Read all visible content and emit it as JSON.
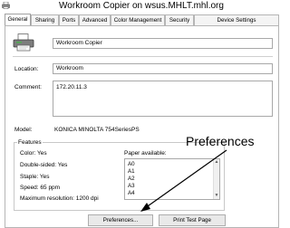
{
  "window": {
    "title": "Workroom Copier on wsus.MHLT.mhl.org"
  },
  "tabs": [
    {
      "label": "General"
    },
    {
      "label": "Sharing"
    },
    {
      "label": "Ports"
    },
    {
      "label": "Advanced"
    },
    {
      "label": "Color Management"
    },
    {
      "label": "Security"
    },
    {
      "label": "Device Settings"
    }
  ],
  "general": {
    "name_value": "Workroom Copier",
    "location_label": "Location:",
    "location_value": "Workroom",
    "comment_label": "Comment:",
    "comment_value": "172.20.11.3",
    "model_label": "Model:",
    "model_value": "KONICA MINOLTA 754SeriesPS"
  },
  "features": {
    "group_label": "Features",
    "color": "Color: Yes",
    "double_sided": "Double-sided: Yes",
    "staple": "Staple: Yes",
    "speed": "Speed: 65 ppm",
    "max_resolution": "Maximum resolution: 1200 dpi",
    "paper_label": "Paper available:",
    "paper_sizes": [
      "A0",
      "A1",
      "A2",
      "A3",
      "A4"
    ]
  },
  "buttons": {
    "preferences": "Preferences...",
    "print_test_page": "Print Test Page"
  },
  "annotation": {
    "text": "Preferences"
  }
}
